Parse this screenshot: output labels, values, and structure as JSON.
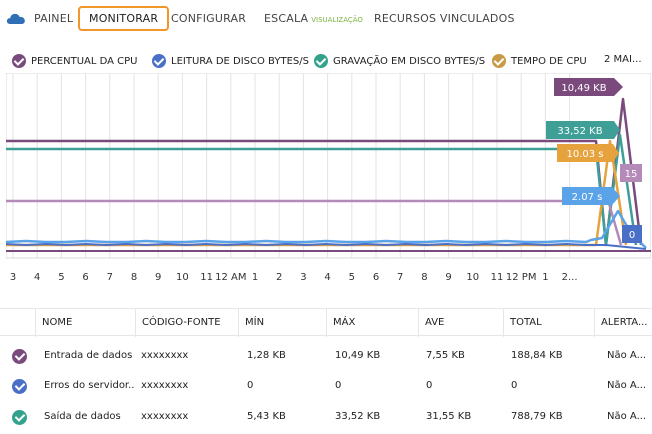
{
  "nav": {
    "items": [
      {
        "label": "PAINEL",
        "active": false
      },
      {
        "label": "MONITORAR",
        "active": true
      },
      {
        "label": "CONFIGURAR",
        "active": false
      },
      {
        "label": "ESCALA",
        "sub": "VISUALIZAÇÃO",
        "active": false
      },
      {
        "label": "RECURSOS VINCULADOS",
        "active": false
      }
    ]
  },
  "legend": {
    "items": [
      {
        "label": "PERCENTUAL DA CPU",
        "color": "#7a4a7d"
      },
      {
        "label": "LEITURA DE DISCO BYTES/S",
        "color": "#4a6fc7"
      },
      {
        "label": "GRAVAÇÃO EM DISCO BYTES/S",
        "color": "#33a28c"
      },
      {
        "label": "TEMPO DE CPU",
        "color": "#c99a45"
      }
    ],
    "more": "2 MAI..."
  },
  "chart_data": {
    "type": "line",
    "x_ticks": [
      "3",
      "4",
      "5",
      "6",
      "7",
      "8",
      "9",
      "10",
      "11",
      "12 AM",
      "1",
      "2",
      "3",
      "4",
      "5",
      "6",
      "7",
      "8",
      "9",
      "10",
      "11",
      "12 PM",
      "1",
      "2..."
    ],
    "series": [
      {
        "color": "#7a4a7d",
        "callout": "10,49 KB"
      },
      {
        "color": "#3e9f96",
        "callout": "33,52 KB"
      },
      {
        "color": "#e6a23c",
        "callout": "10.03 s"
      },
      {
        "color": "#b48ab8",
        "callout": "15"
      },
      {
        "color": "#5ba3e8",
        "callout": "2.07 s"
      },
      {
        "color": "#4a6fc7",
        "callout": "0"
      }
    ]
  },
  "table": {
    "headers": [
      "NOME",
      "CÓDIGO-FONTE",
      "MÍN",
      "MÁX",
      "AVE",
      "TOTAL",
      "ALERTA..."
    ],
    "rows": [
      {
        "color": "#7a4a7d",
        "cells": [
          "Entrada de dados",
          "xxxxxxxx",
          "1,28 KB",
          "10,49 KB",
          "7,55 KB",
          "188,84 KB",
          "Não A..."
        ]
      },
      {
        "color": "#4a6fc7",
        "cells": [
          "Erros do servidor...",
          "xxxxxxxx",
          "0",
          "0",
          "0",
          "0",
          "Não A..."
        ]
      },
      {
        "color": "#33a28c",
        "cells": [
          "Saída de dados",
          "xxxxxxxx",
          "5,43 KB",
          "33,52 KB",
          "31,55 KB",
          "788,79 KB",
          "Não A..."
        ]
      }
    ]
  }
}
